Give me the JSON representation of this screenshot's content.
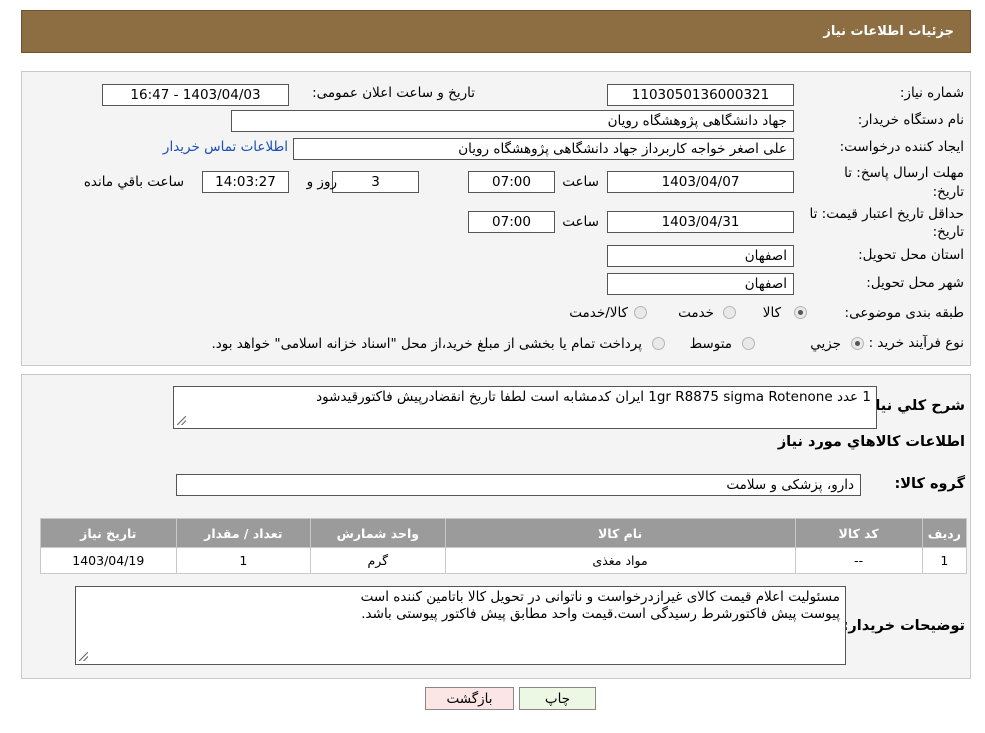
{
  "header": {
    "title": "جزئیات اطلاعات نیاز"
  },
  "details": {
    "need_number_label": "شماره نیاز:",
    "need_number": "1103050136000321",
    "announce_label": "تاریخ و ساعت اعلان عمومی:",
    "announce_value": "1403/04/03 - 16:47",
    "buyer_org_label": "نام دستگاه خریدار:",
    "buyer_org": "جهاد دانشگاهی پژوهشگاه رویان",
    "creator_label": "ایجاد کننده درخواست:",
    "creator": "علی اصغر خواجه کاربرداز جهاد دانشگاهی پژوهشگاه رویان",
    "contact_link": "اطلاعات تماس خریدار",
    "reply_deadline_label_1": "مهلت ارسال پاسخ: تا",
    "reply_deadline_label_2": "تاریخ:",
    "reply_date": "1403/04/07",
    "time_label": "ساعت",
    "reply_time": "07:00",
    "days": "3",
    "days_label": "روز و",
    "remaining_time": "14:03:27",
    "remaining_label": "ساعت باقي مانده",
    "validity_label_1": "حداقل تاریخ اعتبار قیمت: تا",
    "validity_label_2": "تاریخ:",
    "validity_date": "1403/04/31",
    "validity_time": "07:00",
    "province_label": "استان محل تحویل:",
    "province": "اصفهان",
    "city_label": "شهر محل تحویل:",
    "city": "اصفهان",
    "category_label": "طبقه بندی موضوعی:",
    "category_options": [
      "کالا",
      "خدمت",
      "کالا/خدمت"
    ],
    "category_selected": 0,
    "process_label": "نوع فرآیند خرید :",
    "process_options": [
      "جزیي",
      "متوسط"
    ],
    "process_selected": 0,
    "process_note": "پرداخت تمام یا بخشی از مبلغ خرید،از محل \"اسناد خزانه اسلامی\" خواهد بود."
  },
  "needs": {
    "summary_label": "شرح کلي نياز:",
    "summary": "1 عدد      1gr    R8875      sigma        Rotenone ایران کدمشابه است لطفا تاریخ انقضادرپیش فاکتورقیدشود",
    "goods_info_title": "اطلاعات کالاهاي مورد نياز",
    "goods_group_label": "گروه کالا:",
    "goods_group": "دارو، پزشکی و سلامت",
    "table": {
      "headers": [
        "رديف",
        "کد کالا",
        "نام کالا",
        "واحد شمارش",
        "تعداد / مقدار",
        "تاریخ نیاز"
      ],
      "rows": [
        [
          "1",
          "--",
          "مواد مغذی",
          "گرم",
          "1",
          "1403/04/19"
        ]
      ]
    },
    "buyer_notes_label": "توضیحات خریدار:",
    "buyer_notes_line1": "مسئولیت اعلام قیمت کالای غیرازدرخواست و ناتوانی در تحویل کالا باتامین کننده است",
    "buyer_notes_line2": "پیوست پیش فاکتورشرط رسیدگی است.قیمت واحد مطابق پیش فاکتور پیوستی باشد."
  },
  "buttons": {
    "print": "چاپ",
    "back": "بازگشت"
  }
}
